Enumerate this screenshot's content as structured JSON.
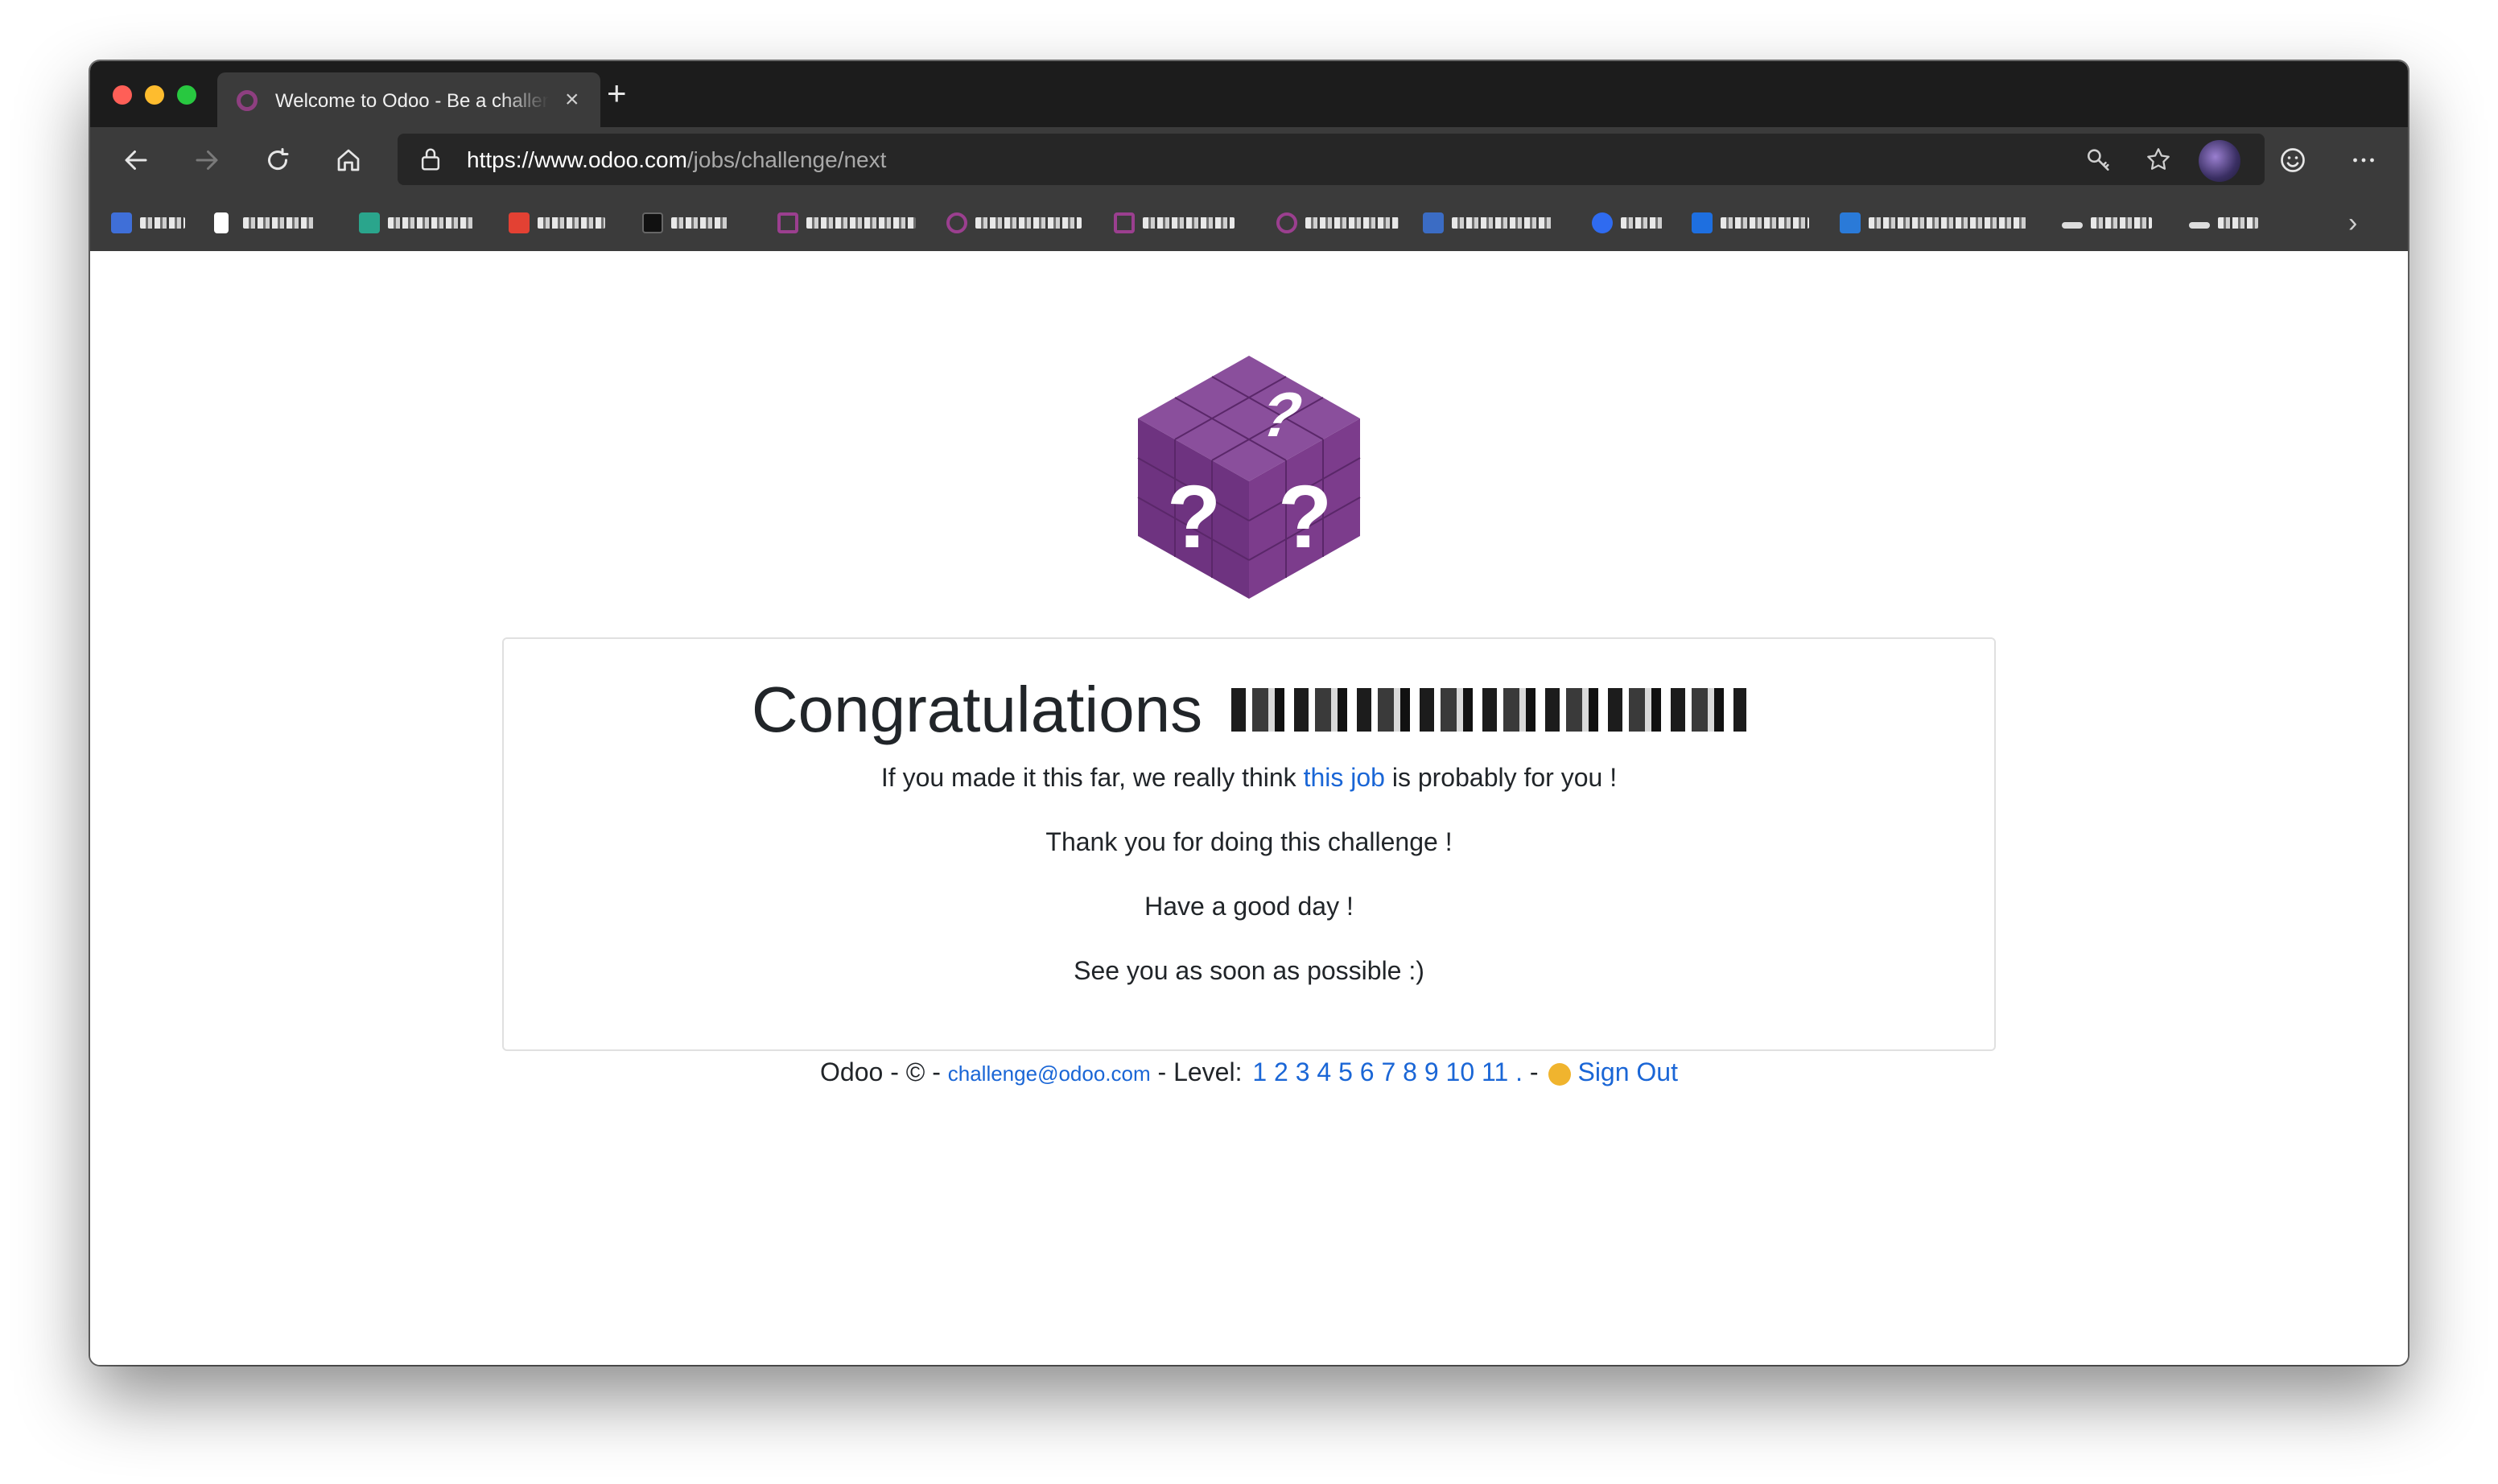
{
  "browser": {
    "tab_title": "Welcome to Odoo - Be a challenger!",
    "tab_close_symbol": "×",
    "new_tab_symbol": "+",
    "url_host": "https://www.odoo.com",
    "url_path": "/jobs/challenge/next",
    "bookmarks_overflow_symbol": "›",
    "bookmark_icon_colors": [
      "#3f6fd8",
      "#ffffff",
      "#2aa58c",
      "#e34133",
      "#111111",
      "#9b3f8f",
      "#9b3f8f",
      "#9b3f8f",
      "#9b3f8f",
      "#3b6cc4",
      "#2f6bf0",
      "#1e6fe0",
      "#2a7ad8",
      "#dddddd",
      "#dddddd"
    ]
  },
  "page": {
    "heading": "Congratulations",
    "line1_before": "If you made it this far, we really think ",
    "line1_link": "this job",
    "line1_after": " is probably for you !",
    "line2": "Thank you for doing this challenge !",
    "line3": "Have a good day !",
    "line4": "See you as soon as possible :)",
    "cube_symbol": "?"
  },
  "footer": {
    "prefix": "Odoo - © - ",
    "email": "challenge@odoo.com",
    "level_label": " - Level: ",
    "levels": [
      "1",
      "2",
      "3",
      "4",
      "5",
      "6",
      "7",
      "8",
      "9",
      "10",
      "11",
      "."
    ],
    "separator": " - ",
    "sign_out": "Sign Out"
  },
  "colors": {
    "link": "#1a66d6",
    "odoo_purple": "#7c3c8c",
    "text": "#212529"
  }
}
